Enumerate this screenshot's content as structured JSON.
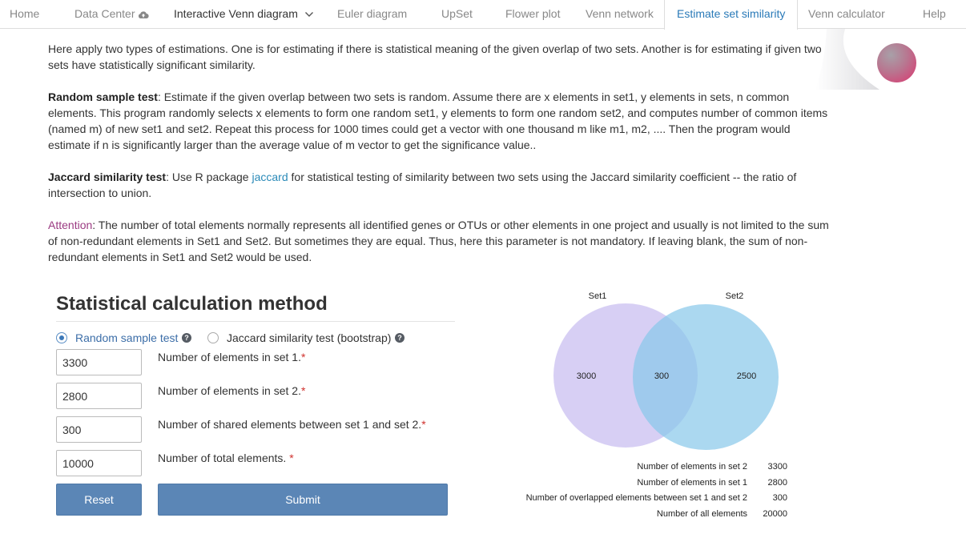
{
  "nav": {
    "items": [
      {
        "label": "Home"
      },
      {
        "label": "Data Center"
      },
      {
        "label": "Interactive Venn diagram"
      },
      {
        "label": "Euler diagram"
      },
      {
        "label": "UpSet"
      },
      {
        "label": "Flower plot"
      },
      {
        "label": "Venn network"
      },
      {
        "label": "Estimate set similarity"
      },
      {
        "label": "Venn calculator"
      },
      {
        "label": "Help"
      }
    ]
  },
  "intro": {
    "p1": "Here apply two types of estimations. One is for estimating if there is statistical meaning of the given overlap of two sets. Another is for estimating if given two sets have statistically significant similarity.",
    "random_title": "Random sample test",
    "random_text": ": Estimate if the given overlap between two sets is random. Assume there are x elements in set1, y elements in sets, n common elements. This program randomly selects x elements to form one random set1, y elements to form one random set2, and computes number of common items (named m) of new set1 and set2. Repeat this process for 1000 times could get a vector with one thousand m like m1, m2, .... Then the program would estimate if n is significantly larger than the average value of m vector to get the significance value..",
    "jaccard_title": "Jaccard similarity test",
    "jaccard_pre": ": Use R package ",
    "jaccard_link": "jaccard",
    "jaccard_post": " for statistical testing of similarity between two sets using the Jaccard similarity coefficient -- the ratio of intersection to union.",
    "attention_title": "Attention",
    "attention_text": ": The number of total elements normally represents all identified genes or OTUs or other elements in one project and usually is not limited to the sum of non-redundant elements in Set1 and Set2. But sometimes they are equal. Thus, here this parameter is not mandatory. If leaving blank, the sum of non-redundant elements in Set1 and Set2 would be used."
  },
  "form": {
    "title": "Statistical calculation method",
    "radio_random": "Random sample test",
    "radio_jaccard": "Jaccard similarity test (bootstrap)",
    "help_glyph": "?",
    "fields": [
      {
        "value": "3300",
        "label": "Number of elements in set 1.",
        "req": "*"
      },
      {
        "value": "2800",
        "label": "Number of elements in set 2.",
        "req": "*"
      },
      {
        "value": "300",
        "label": "Number of shared elements between set 1 and set 2.",
        "req": "*"
      },
      {
        "value": "10000",
        "label": "Number of total elements. ",
        "req": "*"
      }
    ],
    "reset_label": "Reset",
    "submit_label": "Submit"
  },
  "venn": {
    "set1_label": "Set1",
    "set2_label": "Set2",
    "only1": "3000",
    "both": "300",
    "only2": "2500",
    "set1_color": "#c9bff0",
    "set2_color": "#87c8ea"
  },
  "stats": [
    {
      "label": "Number of elements in set 2",
      "value": "3300"
    },
    {
      "label": "Number of elements in set 1",
      "value": "2800"
    },
    {
      "label": "Number of overlapped elements between set 1 and set 2",
      "value": "300"
    },
    {
      "label": "Number of all elements",
      "value": "20000"
    }
  ]
}
